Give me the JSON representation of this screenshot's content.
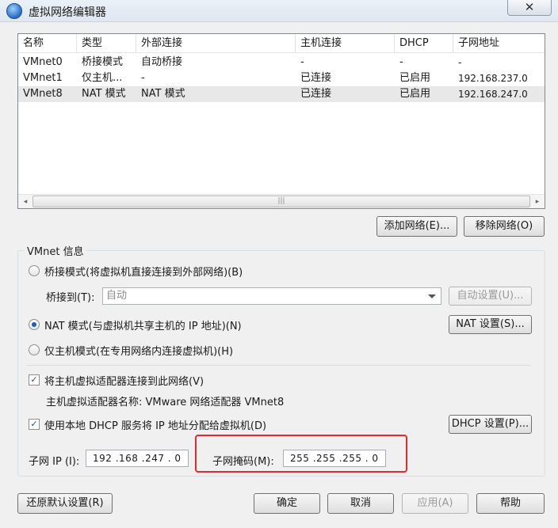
{
  "window": {
    "title": "虚拟网络编辑器",
    "close_glyph": "✕",
    "icon": "network-globe-icon"
  },
  "table": {
    "headers": [
      "名称",
      "类型",
      "外部连接",
      "主机连接",
      "DHCP",
      "子网地址"
    ],
    "rows": [
      [
        "VMnet0",
        "桥接模式",
        "自动桥接",
        "-",
        "-",
        "-"
      ],
      [
        "VMnet1",
        "仅主机...",
        "-",
        "已连接",
        "已启用",
        "192.168.237.0"
      ],
      [
        "VMnet8",
        "NAT 模式",
        "NAT 模式",
        "已连接",
        "已启用",
        "192.168.247.0"
      ]
    ],
    "selected_row": 2,
    "scroll_left": "◂",
    "scroll_right": "▸",
    "scroll_grip": "|||"
  },
  "buttons": {
    "add_network": "添加网络(E)...",
    "remove_network": "移除网络(O)",
    "auto_settings": "自动设置(U)...",
    "nat_settings": "NAT 设置(S)...",
    "dhcp_settings": "DHCP 设置(P)...",
    "restore_defaults": "还原默认设置(R)",
    "ok": "确定",
    "cancel": "取消",
    "apply": "应用(A)",
    "help": "帮助"
  },
  "vmnet_info": {
    "title": "VMnet 信息",
    "bridged_label": "桥接模式(将虚拟机直接连接到外部网络)(B)",
    "bridged_to_label": "桥接到(T):",
    "bridged_to_value": "自动",
    "nat_label": "NAT 模式(与虚拟机共享主机的 IP 地址)(N)",
    "hostonly_label": "仅主机模式(在专用网络内连接虚拟机)(H)",
    "selected_mode": "nat",
    "connect_adapter_label": "将主机虚拟适配器连接到此网络(V)",
    "connect_adapter_checked": true,
    "adapter_name_label": "主机虚拟适配器名称: VMware 网络适配器 VMnet8",
    "use_dhcp_label": "使用本地 DHCP 服务将 IP 地址分配给虚拟机(D)",
    "use_dhcp_checked": true,
    "check_glyph": "✓",
    "subnet_ip_label": "子网 IP (I):",
    "subnet_ip_value": "192 .168 .247 . 0",
    "subnet_mask_label": "子网掩码(M):",
    "subnet_mask_value": "255 .255 .255 . 0"
  },
  "colors": {
    "highlight_box": "#e32b2b",
    "selection": "#e8e8e8",
    "radio_dot": "#1e5fb3"
  }
}
